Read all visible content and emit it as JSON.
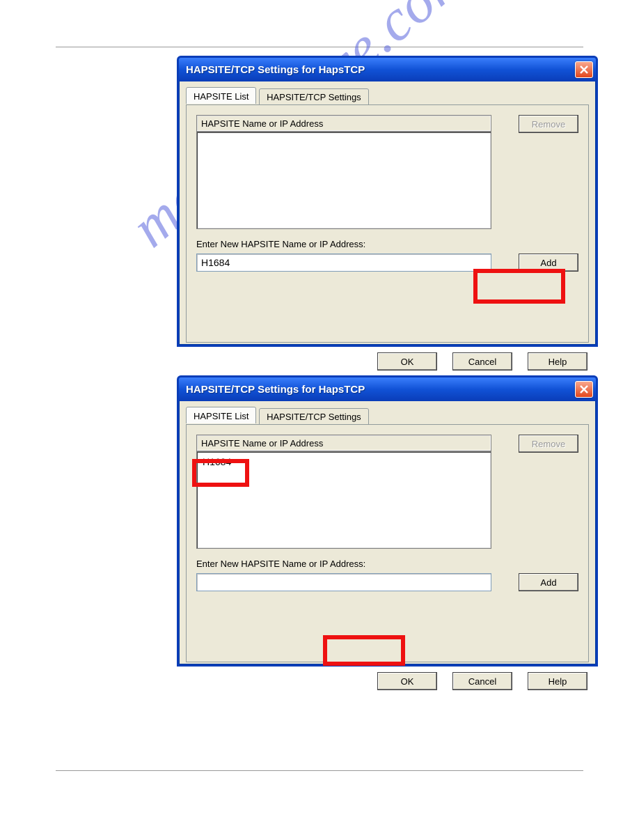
{
  "watermark": "manualshive.com",
  "dialog1": {
    "title": "HAPSITE/TCP Settings for HapsTCP",
    "tabs": {
      "tab1": "HAPSITE List",
      "tab2": "HAPSITE/TCP Settings"
    },
    "list_header": "HAPSITE Name or IP Address",
    "list_items": [],
    "remove_label": "Remove",
    "enter_label": "Enter New HAPSITE Name or IP Address:",
    "input_value": "H1684",
    "add_label": "Add",
    "ok_label": "OK",
    "cancel_label": "Cancel",
    "help_label": "Help"
  },
  "dialog2": {
    "title": "HAPSITE/TCP Settings for HapsTCP",
    "tabs": {
      "tab1": "HAPSITE List",
      "tab2": "HAPSITE/TCP Settings"
    },
    "list_header": "HAPSITE Name or IP Address",
    "list_items": [
      "H1684"
    ],
    "remove_label": "Remove",
    "enter_label": "Enter New HAPSITE Name or IP Address:",
    "input_value": "",
    "add_label": "Add",
    "ok_label": "OK",
    "cancel_label": "Cancel",
    "help_label": "Help"
  }
}
